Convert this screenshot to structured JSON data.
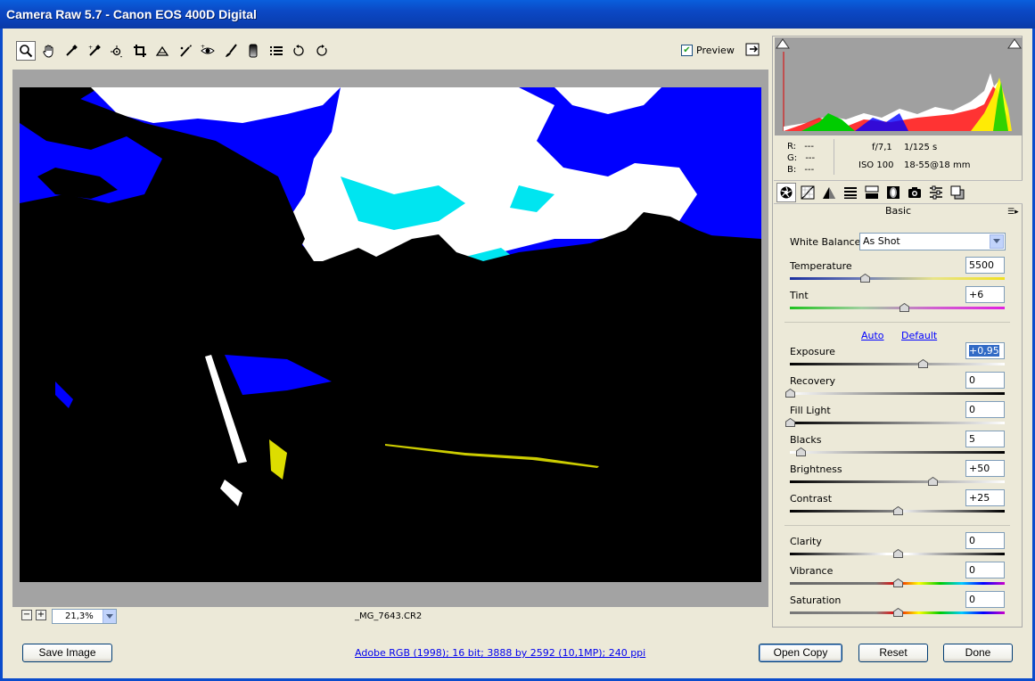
{
  "window": {
    "title": "Camera Raw 5.7  -  Canon EOS 400D Digital"
  },
  "toolbar": {
    "tools": [
      {
        "icon": "zoom-icon",
        "active": true
      },
      {
        "icon": "hand-icon"
      },
      {
        "icon": "white-balance-eyedropper-icon"
      },
      {
        "icon": "color-sampler-icon"
      },
      {
        "icon": "target-adjustment-icon"
      },
      {
        "icon": "crop-icon"
      },
      {
        "icon": "straighten-icon"
      },
      {
        "icon": "spot-removal-icon"
      },
      {
        "icon": "red-eye-icon"
      },
      {
        "icon": "adjustment-brush-icon"
      },
      {
        "icon": "graduated-filter-icon"
      },
      {
        "icon": "preferences-icon"
      },
      {
        "icon": "rotate-ccw-icon"
      },
      {
        "icon": "rotate-cw-icon"
      }
    ],
    "preview_label": "Preview",
    "preview_checked": true
  },
  "preview": {
    "zoom_value": "21,3%",
    "filename": "_MG_7643.CR2"
  },
  "info": {
    "r_label": "R:",
    "r_value": "---",
    "g_label": "G:",
    "g_value": "---",
    "b_label": "B:",
    "b_value": "---",
    "aperture": "f/7,1",
    "shutter": "1/125 s",
    "iso": "ISO 100",
    "lens": "18-55@18 mm"
  },
  "panel": {
    "title": "Basic",
    "tabs": [
      "basic-icon",
      "tone-curve-icon",
      "detail-icon",
      "hsl-icon",
      "split-toning-icon",
      "lens-corrections-icon",
      "camera-calibration-icon",
      "presets-icon",
      "snapshots-icon"
    ],
    "white_balance_label": "White Balance:",
    "white_balance_value": "As Shot",
    "auto_label": "Auto",
    "default_label": "Default",
    "sliders": [
      {
        "label": "Temperature",
        "value": "5500",
        "pos": 0.35
      },
      {
        "label": "Tint",
        "value": "+6",
        "pos": 0.53
      },
      {
        "label": "Exposure",
        "value": "+0,95",
        "pos": 0.62
      },
      {
        "label": "Recovery",
        "value": "0",
        "pos": 0.0
      },
      {
        "label": "Fill Light",
        "value": "0",
        "pos": 0.0
      },
      {
        "label": "Blacks",
        "value": "5",
        "pos": 0.05
      },
      {
        "label": "Brightness",
        "value": "+50",
        "pos": 0.665
      },
      {
        "label": "Contrast",
        "value": "+25",
        "pos": 0.5
      },
      {
        "label": "Clarity",
        "value": "0",
        "pos": 0.5
      },
      {
        "label": "Vibrance",
        "value": "0",
        "pos": 0.5
      },
      {
        "label": "Saturation",
        "value": "0",
        "pos": 0.5
      }
    ]
  },
  "footer": {
    "save_label": "Save Image",
    "workflow_text": "Adobe RGB (1998); 16 bit; 3888 by 2592 (10,1MP); 240 ppi",
    "open_label": "Open Copy",
    "reset_label": "Reset",
    "done_label": "Done"
  }
}
